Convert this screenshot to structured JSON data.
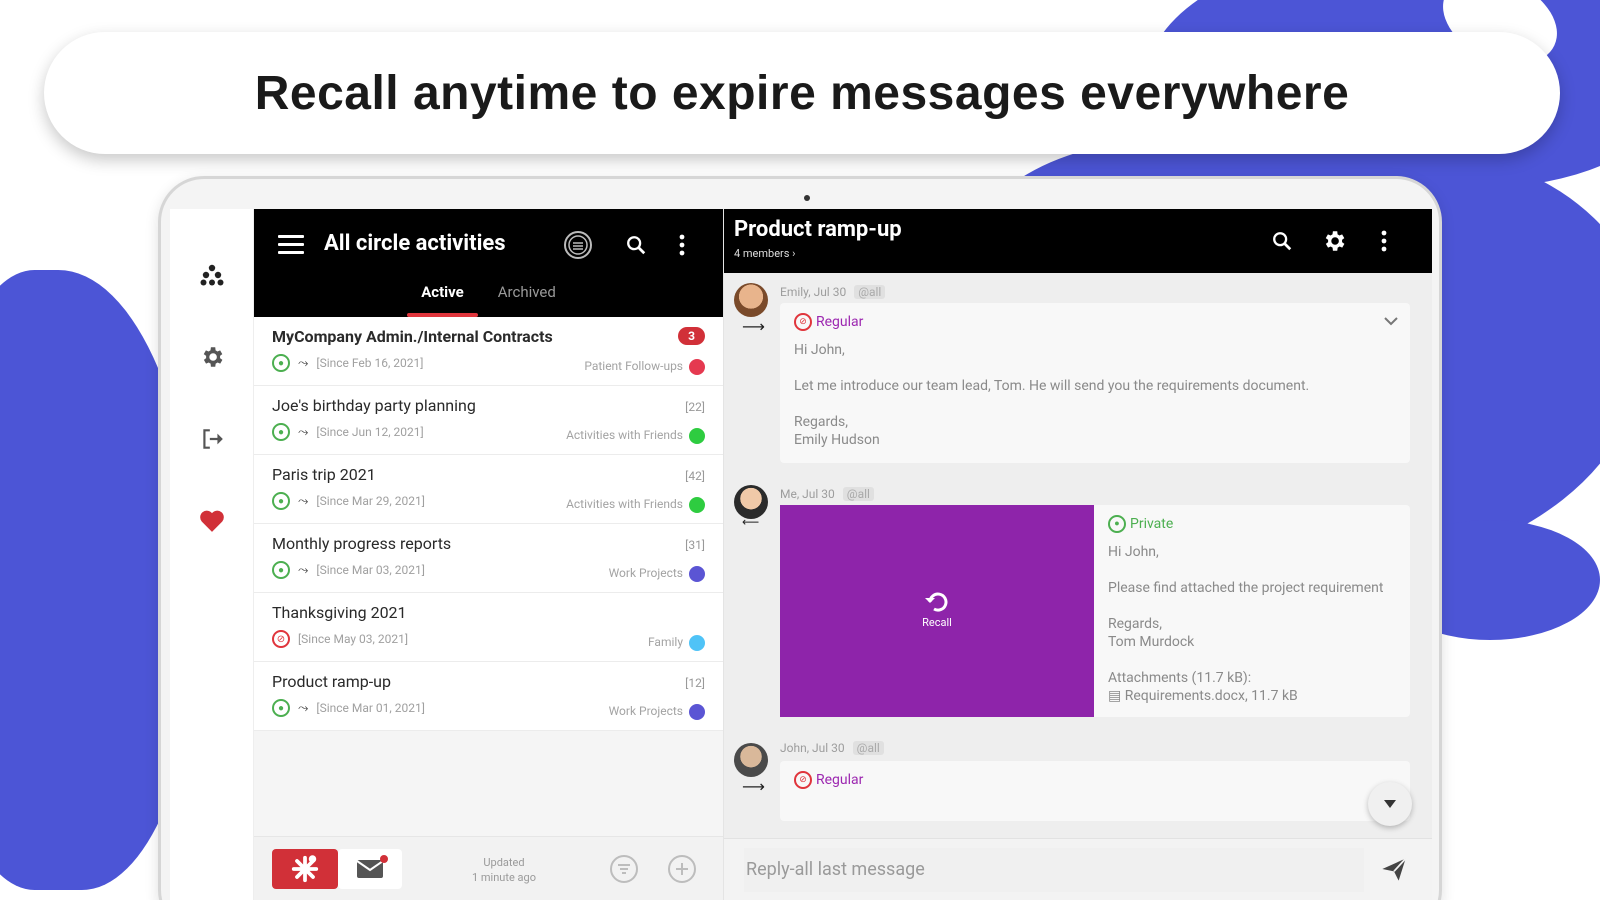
{
  "headline": "Recall anytime to expire messages everywhere",
  "colors": {
    "brand_blue": "#4c55d6",
    "accent_red": "#d13038",
    "recall_purple": "#8e24aa",
    "regular_purple": "#9c27b0",
    "private_green": "#4caf50"
  },
  "left": {
    "title": "All circle activities",
    "tabs": [
      {
        "label": "Active",
        "active": true
      },
      {
        "label": "Archived",
        "active": false
      }
    ],
    "items": [
      {
        "title": "MyCompany Admin./Internal Contracts",
        "count": "3",
        "badge": true,
        "since": "[Since Feb 16, 2021]",
        "category": "Patient Follow-ups",
        "dot_color": "#e53950",
        "status": "green",
        "forward": true,
        "bold": true
      },
      {
        "title": "Joe's birthday party planning",
        "count": "[22]",
        "badge": false,
        "since": "[Since Jun 12, 2021]",
        "category": "Activities with Friends",
        "dot_color": "#2ecc40",
        "status": "green",
        "forward": true,
        "bold": false
      },
      {
        "title": "Paris trip 2021",
        "count": "[42]",
        "badge": false,
        "since": "[Since Mar 29, 2021]",
        "category": "Activities with Friends",
        "dot_color": "#2ecc40",
        "status": "green",
        "forward": true,
        "bold": false
      },
      {
        "title": "Monthly progress reports",
        "count": "[31]",
        "badge": false,
        "since": "[Since Mar 03, 2021]",
        "category": "Work Projects",
        "dot_color": "#5b55d4",
        "status": "green",
        "forward": true,
        "bold": false
      },
      {
        "title": "Thanksgiving 2021",
        "count": "",
        "badge": false,
        "since": "[Since May 03, 2021]",
        "category": "Family",
        "dot_color": "#4fc3f7",
        "status": "red",
        "forward": false,
        "bold": false
      },
      {
        "title": "Product ramp-up",
        "count": "[12]",
        "badge": false,
        "since": "[Since Mar 01, 2021]",
        "category": "Work Projects",
        "dot_color": "#5b55d4",
        "status": "green",
        "forward": true,
        "bold": false
      }
    ],
    "updated_line1": "Updated",
    "updated_line2": "1 minute ago"
  },
  "chat": {
    "title": "Product ramp-up",
    "subtitle": "4 members ›",
    "messages": [
      {
        "author_meta": "Emily, Jul 30",
        "at": "@all",
        "tag": "Regular",
        "lines": [
          "Hi John,",
          "Let me introduce our team lead, Tom. He will send you the requirements document.",
          "Regards,",
          "Emily Hudson"
        ]
      },
      {
        "author_meta": "Me, Jul 30",
        "at": "@all",
        "tag": "Private",
        "recall_label": "Recall",
        "lines": [
          "Hi John,",
          "Please find attached the project requirement",
          "Regards,",
          "Tom Murdock",
          "Attachments (11.7 kB):",
          "Requirements.docx, 11.7 kB"
        ]
      },
      {
        "author_meta": "John, Jul 30",
        "at": "@all",
        "tag": "Regular"
      }
    ],
    "reply_placeholder": "Reply-all last message"
  }
}
